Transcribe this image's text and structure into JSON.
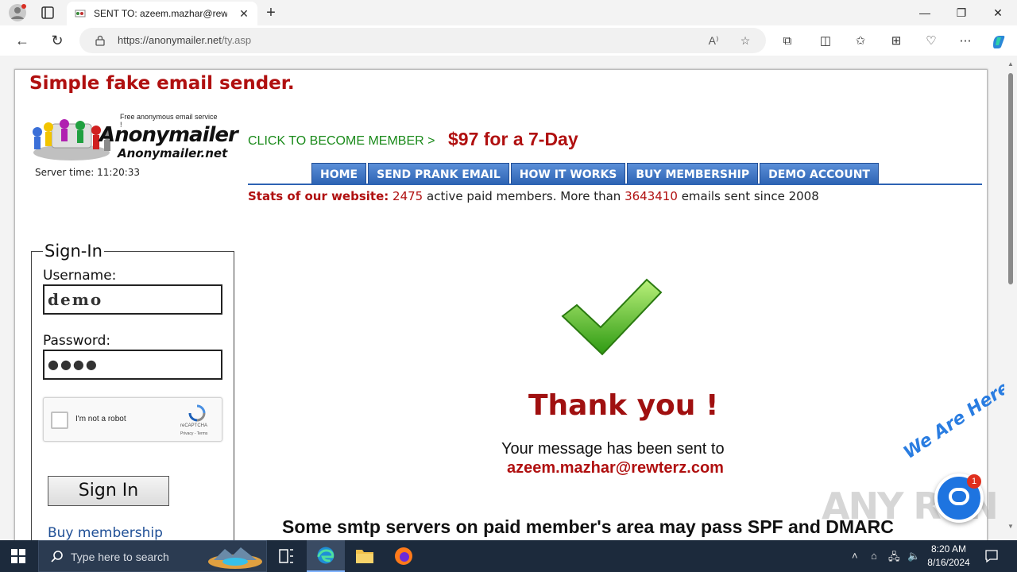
{
  "browser": {
    "tab_title": "SENT TO: azeem.mazhar@rewterz.com",
    "url_host": "https://anonymailer.net",
    "url_path": "/ty.asp",
    "new_tab": "+",
    "tab_close": "✕",
    "minimize": "—",
    "maximize": "❐",
    "close": "✕"
  },
  "page": {
    "headline": "Simple fake email sender.",
    "logo": {
      "tagline": "Free anonymous email service !",
      "name": "Anonymailer",
      "domain": "Anonymailer.net"
    },
    "server_time_label": "Server time: 11:20:33",
    "cta": "CLICK TO BECOME MEMBER >",
    "price": "$97 for a 7-Day",
    "nav": [
      "HOME",
      "SEND PRANK EMAIL",
      "HOW IT WORKS",
      "BUY MEMBERSHIP",
      "DEMO ACCOUNT"
    ],
    "stats": {
      "label": "Stats of our website:",
      "members": "2475",
      "members_text": "active paid members. More than",
      "emails": "3643410",
      "emails_text": "emails sent since 2008"
    },
    "signin": {
      "legend": "Sign-In",
      "username_label": "Username:",
      "username_value": "demo",
      "password_label": "Password:",
      "password_value": "●●●●",
      "captcha_text": "I'm not a robot",
      "captcha_brand": "reCAPTCHA",
      "captcha_links": "Privacy - Terms",
      "button": "Sign In",
      "buy_link": "Buy membership"
    },
    "confirmation": {
      "title": "Thank you !",
      "message": "Your message has been sent to",
      "email": "azeem.mazhar@rewterz.com"
    },
    "smtp_note": "Some smtp servers on paid member's area may pass SPF and DMARC",
    "chat": {
      "tagline": "We Are Here!",
      "badge": "1"
    },
    "watermark": "ANY RUN"
  },
  "taskbar": {
    "search_placeholder": "Type here to search",
    "time": "8:20 AM",
    "date": "8/16/2024"
  },
  "colors": {
    "accent_red": "#b01010",
    "cta_green": "#1a8a1a",
    "nav_blue": "#2d63b3",
    "taskbar": "#1c2a3c"
  }
}
